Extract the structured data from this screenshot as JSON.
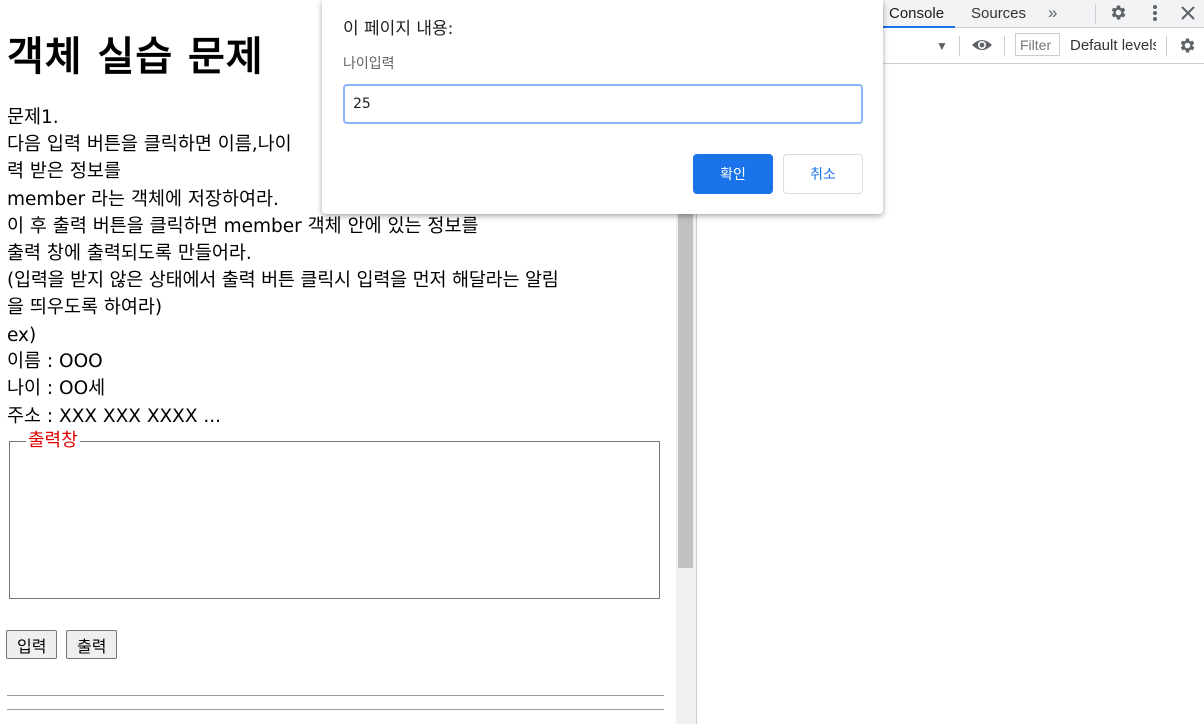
{
  "page": {
    "title": "객체 실습 문제",
    "problem_lines": [
      "문제1.",
      "다음 입력 버튼을 클릭하면 이름,나이",
      "력 받은 정보를",
      "member 라는 객체에 저장하여라.",
      "이 후 출력 버튼을 클릭하면 member 객체 안에 있는 정보를",
      "출력 창에 출력되도록 만들어라.",
      "(입력을 받지 않은 상태에서 출력 버튼 클릭시 입력을 먼저 해달라는 알림",
      "을 띄우도록 하여라)"
    ],
    "example_lines": [
      "ex)",
      "이름 : OOO",
      "나이 : OO세",
      "주소 : XXX XXX XXXX ..."
    ],
    "output_legend": "출력창",
    "input_button": "입력",
    "output_button": "출력"
  },
  "dialog": {
    "title": "이 페이지 내용:",
    "message": "나이입력",
    "input_value": "25",
    "ok_label": "확인",
    "cancel_label": "취소"
  },
  "devtools": {
    "tabs": [
      "Console",
      "Sources"
    ],
    "active_tab": "Console",
    "more_tabs_icon": "double-chevron-right-icon",
    "filter_placeholder": "Filter",
    "levels_label": "Default levels"
  },
  "colors": {
    "accent": "#1a73e8",
    "legend_red": "#e00000",
    "input_focus": "#8ab4f8"
  }
}
